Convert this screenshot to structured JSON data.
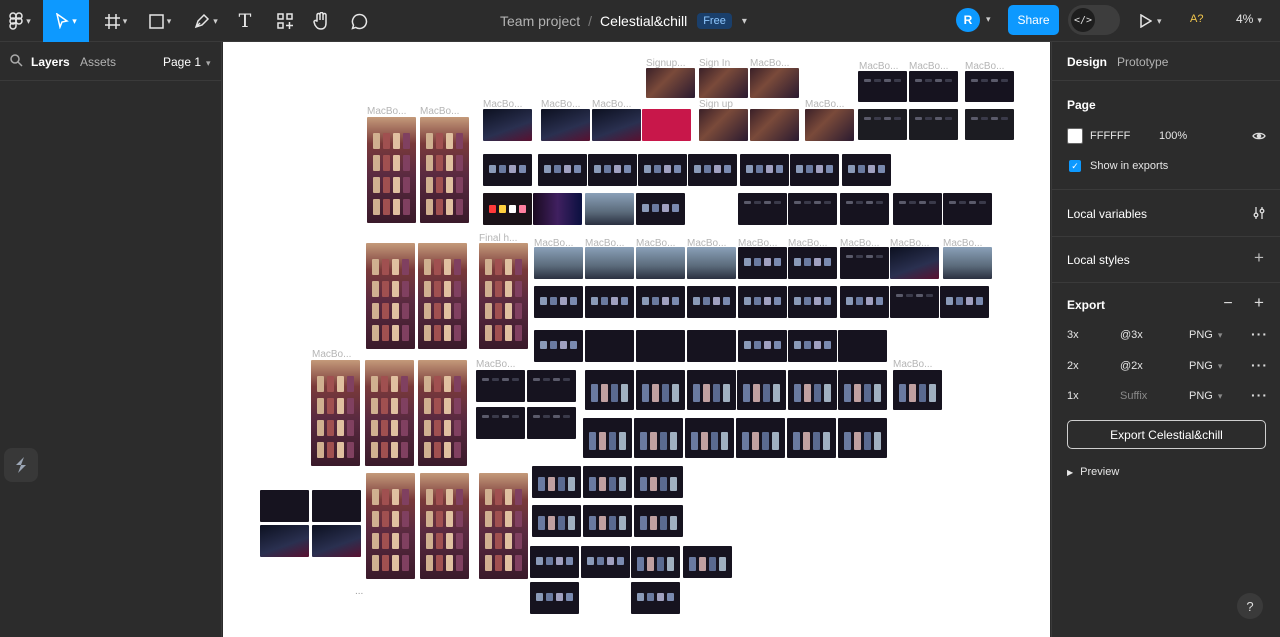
{
  "toolbar": {
    "tools": [
      "main-menu",
      "move",
      "frame",
      "shape",
      "pen",
      "text",
      "resources",
      "hand",
      "comment"
    ],
    "text_tool_glyph": "T"
  },
  "file": {
    "project": "Team project",
    "separator": "/",
    "name": "Celestial&chill",
    "plan_badge": "Free"
  },
  "header_right": {
    "avatar_initial": "R",
    "share_label": "Share",
    "dev_mode_glyph": "</>",
    "assistant_label": "A?",
    "zoom": "4%"
  },
  "left_panel": {
    "tabs": [
      "Layers",
      "Assets"
    ],
    "page_selector": "Page 1"
  },
  "canvas": {
    "frame_labels": [
      "Signup...",
      "Sign In",
      "MacBo...",
      "MacBo...",
      "MacBo...",
      "MacBo...",
      "MacBo...",
      "MacBo...",
      "MacBo...",
      "MacBo...",
      "MacBo...",
      "Sign up",
      "MacBo...",
      "Final h...",
      "MacBo...",
      "MacBo...",
      "MacBo...",
      "MacBo...",
      "MacBo...",
      "MacBo...",
      "MacBo...",
      "MacBo...",
      "MacBo...",
      "MacBo...",
      "MacBo...",
      "MacBo..."
    ],
    "ellipsis": "..."
  },
  "right_panel": {
    "tabs": [
      "Design",
      "Prototype"
    ],
    "page": {
      "title": "Page",
      "color_hex": "FFFFFF",
      "opacity": "100%",
      "show_in_exports": "Show in exports"
    },
    "local_variables": "Local variables",
    "local_styles": "Local styles",
    "export": {
      "title": "Export",
      "rows": [
        {
          "scale": "3x",
          "suffix": "@3x",
          "format": "PNG"
        },
        {
          "scale": "2x",
          "suffix": "@2x",
          "format": "PNG"
        },
        {
          "scale": "1x",
          "suffix": "Suffix",
          "format": "PNG"
        }
      ],
      "button": "Export Celestial&chill",
      "preview": "Preview"
    }
  },
  "help_glyph": "?",
  "colors": {
    "accent": "#0d99ff",
    "panel": "#2c2c2c",
    "canvas": "#ffffff",
    "dark_frame": "#16131f",
    "poster_frame": "#5a2a30",
    "crimson": "#c8174a"
  }
}
